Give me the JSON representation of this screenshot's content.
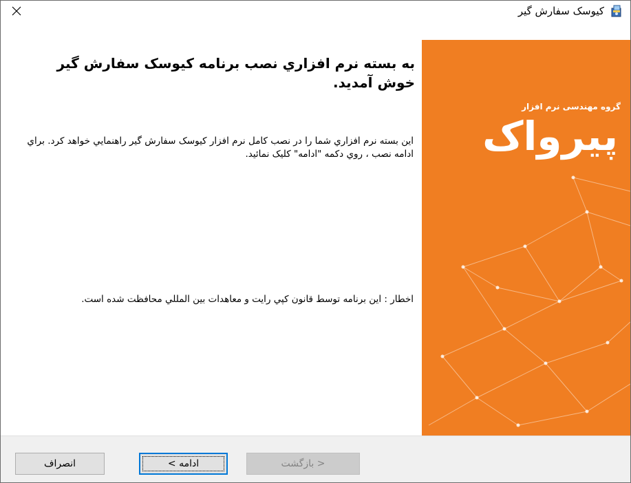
{
  "window": {
    "title": "كيوسک سفارش گير",
    "app_icon": "installer-package-icon",
    "close_icon": "close-icon"
  },
  "main": {
    "heading": "به بسته نرم افزاري نصب برنامه كيوسک سفارش گير خوش آمديد.",
    "intro": "اين بسته نرم افزاري شما را در نصب كامل نرم افزار كيوسک سفارش گير راهنمايي خواهد كرد. براي ادامه نصب ، روي دكمه \"ادامه\" كليک نمائيد.",
    "warning": "اخطار : اين برنامه توسط قانون كپي رايت و معاهدات بين المللي محافظت شده است."
  },
  "banner": {
    "logo_tagline": "گروه مهندسی نرم افزار",
    "logo_word": "پیرواک",
    "background_color": "#f07e22"
  },
  "footer": {
    "back_label": "< بازگشت",
    "next_label": "ادامه >",
    "cancel_label": "انصراف"
  }
}
